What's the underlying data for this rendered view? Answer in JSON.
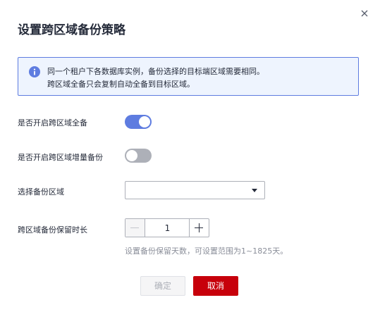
{
  "dialog": {
    "title": "设置跨区域备份策略",
    "close_icon": "close-icon"
  },
  "notice": {
    "icon": "info-icon",
    "line1": "同一个租户下各数据库实例，备份选择的目标端区域需要相同。",
    "line2": "跨区域全备只会复制自动全备到目标区域。"
  },
  "form": {
    "full_backup": {
      "label": "是否开启跨区域全备",
      "enabled": true
    },
    "incremental_backup": {
      "label": "是否开启跨区域增量备份",
      "enabled": false
    },
    "region": {
      "label": "选择备份区域",
      "value": ""
    },
    "retention": {
      "label": "跨区域备份保留时长",
      "value": "1",
      "hint": "设置备份保留天数，可设置范围为1~1825天。"
    }
  },
  "buttons": {
    "ok_label": "确定",
    "cancel_label": "取消"
  },
  "colors": {
    "accent": "#5e7ce0",
    "danger": "#c7000b",
    "switch_off": "#adb0b8",
    "notice_bg": "#eef4fe"
  }
}
